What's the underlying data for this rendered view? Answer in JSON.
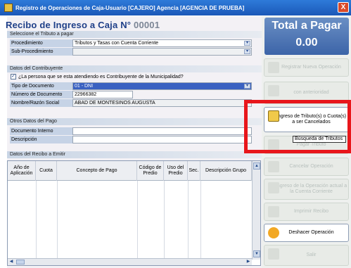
{
  "window": {
    "title": "Registro de Operaciones de Caja-Usuario [CAJERO] Agencia [AGENCIA DE PRUEBA]",
    "close_label": "X"
  },
  "header": {
    "title": "Recibo de Ingreso a Caja N°",
    "number": "00001"
  },
  "tributo": {
    "section": "Seleccione el Tributo a pagar",
    "procedimiento_label": "Procedimiento",
    "procedimiento_value": "Tributos y Tasas con Cuenta Corriente",
    "subprocedimiento_label": "Sub-Procedimiento",
    "subprocedimiento_value": ""
  },
  "contribuyente": {
    "section": "Datos del Contribuyente",
    "question": "¿La persona que se esta atendiendo es Contribuyente de la Municipalidad?",
    "checked": true,
    "tipo_label": "Tipo de Documento",
    "tipo_value": "01 - DNI",
    "numero_label": "Número de Documento",
    "numero_value": "22966382",
    "nombre_label": "Nombre/Razón Social",
    "nombre_value": "ABAD DE MONTESINOS AUGUSTA"
  },
  "otros": {
    "section": "Otros Datos del Pago",
    "doc_label": "Documento Interno",
    "doc_value": "",
    "desc_label": "Descripción",
    "desc_value": ""
  },
  "recibo": {
    "section": "Datos del Recibo a Emitir",
    "columns": [
      "Año de Aplicación",
      "Cuota",
      "Concepto de Pago",
      "Código de Predio",
      "Uso del Predio",
      "Sec.",
      "Descripción Grupo"
    ]
  },
  "total": {
    "label": "Total a Pagar",
    "value": "0.00"
  },
  "actions": {
    "registrar": "Registrar Nueva Operación",
    "anterioridad": "con anterioridad",
    "ingreso_tributo": "Ingreso de Tributo(s) o Cuota(s) a ser Cancelados",
    "pagar": "Pagar Tributo",
    "cancelar": "Cancelar Operación",
    "ingreso_cuenta": "Ingreso de la Operación actual a la Cuenta Corriente",
    "imprimir": "Imprimir Recibo",
    "deshacer": "Deshacer Operación",
    "salir": "Salir"
  },
  "tooltip": "Búsqueda de Tributos",
  "colors": {
    "accent": "#1e3f88",
    "highlight": "#e8161b",
    "selection": "#3a61c1"
  }
}
